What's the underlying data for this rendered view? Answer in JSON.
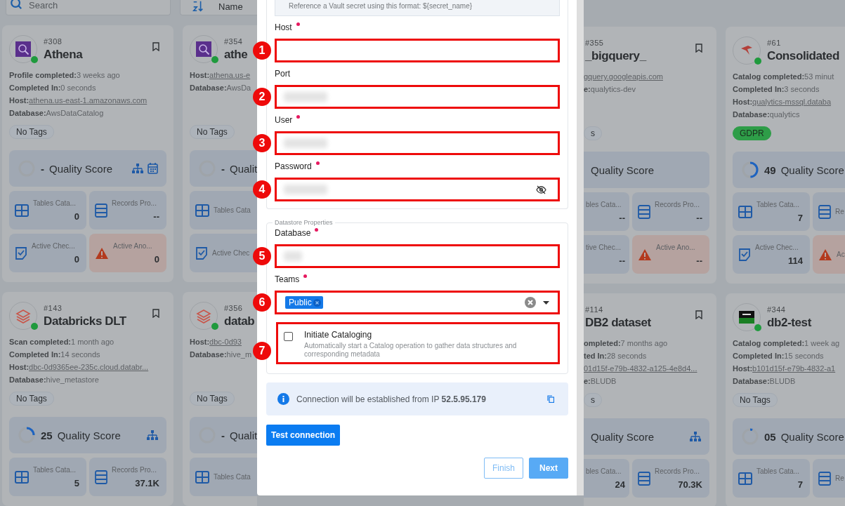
{
  "toolbar": {
    "search_placeholder": "Search",
    "sort_value": "Name"
  },
  "card_columns": [
    {
      "cards": [
        {
          "id": "#308",
          "title": "Athena",
          "logo": {
            "kind": "athena"
          },
          "online": true,
          "bookmark": true,
          "info": [
            {
              "label": "Profile completed:",
              "value": "3 weeks ago",
              "link": false
            },
            {
              "label": "Completed In:",
              "value": "0 seconds",
              "link": false
            },
            {
              "label": "Host:",
              "value": "athena.us-east-1.amazonaws.com",
              "link": true
            },
            {
              "label": "Database:",
              "value": "AwsDataCatalog",
              "link": false
            }
          ],
          "tag": {
            "label": "No Tags",
            "kind": "empty"
          },
          "quality": {
            "score": "-",
            "label": "Quality Score",
            "icons": [
              {
                "kind": "tree"
              },
              {
                "kind": "calendar"
              }
            ]
          },
          "stat_rows": [
            [
              {
                "kind": "tables",
                "label": "Tables Cata...",
                "value": "0"
              },
              {
                "kind": "records",
                "label": "Records Pro...",
                "value": "--"
              }
            ],
            [
              {
                "kind": "checks",
                "label": "Active Chec...",
                "value": "0"
              },
              {
                "kind": "anomalies",
                "label": "Active Ano...",
                "value": "0"
              }
            ]
          ]
        },
        {
          "id": "#143",
          "title": "Databricks DLT",
          "logo": {
            "kind": "databricks"
          },
          "online": true,
          "bookmark": true,
          "info": [
            {
              "label": "Scan completed:",
              "value": "1 month ago",
              "link": false
            },
            {
              "label": "Completed In:",
              "value": "14 seconds",
              "link": false
            },
            {
              "label": "Host:",
              "value": "dbc-0d9365ee-235c.cloud.databr...",
              "link": true
            },
            {
              "label": "Database:",
              "value": "hive_metastore",
              "link": false
            }
          ],
          "tag": {
            "label": "No Tags",
            "kind": "empty"
          },
          "quality": {
            "score": "25",
            "label": "Quality Score",
            "icons": [
              {
                "kind": "tree"
              }
            ]
          },
          "stat_rows": [
            [
              {
                "kind": "tables",
                "label": "Tables Cata...",
                "value": "5"
              },
              {
                "kind": "records",
                "label": "Records Pro...",
                "value": "37.1K"
              }
            ]
          ]
        }
      ]
    },
    {
      "cards": [
        {
          "id": "#354",
          "title": "athe",
          "logo": {
            "kind": "athena"
          },
          "online": true,
          "info": [
            {
              "label": "Host:",
              "value": "athena.us-e",
              "link": true
            },
            {
              "label": "Database:",
              "value": "AwsDa",
              "link": false
            }
          ],
          "tag": {
            "label": "No Tags",
            "kind": "empty"
          },
          "quality": {
            "score": "-",
            "label": "Qualit"
          },
          "stat_rows": [
            [
              {
                "kind": "tables",
                "label": "Tables Cata"
              }
            ],
            [
              {
                "kind": "checks",
                "label": "Active Chec"
              }
            ]
          ]
        },
        {
          "id": "#356",
          "title": "datab",
          "logo": {
            "kind": "databricks"
          },
          "online": true,
          "info": [
            {
              "label": "Host:",
              "value": "dbc-0d93",
              "link": true
            },
            {
              "label": "Database:",
              "value": "hive_m",
              "link": false
            }
          ],
          "tag": {
            "label": "No Tags",
            "kind": "empty"
          },
          "quality": {
            "score": "-",
            "label": "Qualit"
          },
          "stat_rows": [
            [
              {
                "kind": "tables",
                "label": "Tables Cata"
              }
            ]
          ]
        }
      ]
    },
    {
      "cards": [
        {
          "id": "#355",
          "title": "_bigquery_",
          "bookmark": true,
          "info": [
            {
              "value": "gquery.googleapis.com",
              "link": true
            },
            {
              "label": "e:",
              "value": "qualytics-dev",
              "link": false
            }
          ],
          "tag": {
            "label": "s",
            "kind": "empty"
          },
          "quality": {
            "label": "Quality Score"
          },
          "stat_rows": [
            [
              {
                "label": "bles Cata...",
                "value": "--"
              },
              {
                "kind": "records",
                "label": "Records Pro...",
                "value": "--"
              }
            ],
            [
              {
                "label": "tive Chec...",
                "value": "--"
              },
              {
                "kind": "anomalies",
                "label": "Active Ano...",
                "value": "--"
              }
            ]
          ]
        },
        {
          "id": "#114",
          "title": "DB2 dataset",
          "bookmark": true,
          "info": [
            {
              "label": "ompleted:",
              "value": "7 months ago",
              "link": false
            },
            {
              "label": "ted In:",
              "value": "28 seconds",
              "link": false
            },
            {
              "value": "01d15f-e79b-4832-a125-4e8d4...",
              "link": true
            },
            {
              "label": "e:",
              "value": "BLUDB",
              "link": false
            }
          ],
          "tag": {
            "label": "s",
            "kind": "empty"
          },
          "quality": {
            "label": "Quality Score",
            "icons": [
              {
                "kind": "tree"
              }
            ]
          },
          "stat_rows": [
            [
              {
                "label": "bles Cata...",
                "value": "24"
              },
              {
                "kind": "records",
                "label": "Records Pro...",
                "value": "70.3K"
              }
            ]
          ]
        }
      ]
    },
    {
      "cards": [
        {
          "id": "#61",
          "title": "Consolidated",
          "logo": {
            "kind": "mssql"
          },
          "online": true,
          "info": [
            {
              "label": "Catalog completed:",
              "value": "53 minut",
              "link": false
            },
            {
              "label": "Completed In:",
              "value": "3 seconds",
              "link": false
            },
            {
              "label": "Host:",
              "value": "qualytics-mssql.databa",
              "link": true
            },
            {
              "label": "Database:",
              "value": "qualytics",
              "link": false
            }
          ],
          "tag": {
            "label": "GDPR",
            "kind": "gdpr"
          },
          "quality": {
            "score": "49",
            "label": "Quality Score"
          },
          "stat_rows": [
            [
              {
                "kind": "tables",
                "label": "Tables Cata...",
                "value": "7"
              },
              {
                "kind": "records",
                "label": "Re"
              }
            ],
            [
              {
                "kind": "checks",
                "label": "Active Chec...",
                "value": "114"
              },
              {
                "kind": "anomalies",
                "label": "Ac"
              }
            ]
          ]
        },
        {
          "id": "#344",
          "title": "db2-test",
          "logo": {
            "kind": "ibm"
          },
          "online": true,
          "info": [
            {
              "label": "Catalog completed:",
              "value": "1 week ag",
              "link": false
            },
            {
              "label": "Completed In:",
              "value": "15 seconds",
              "link": false
            },
            {
              "label": "Host:",
              "value": "b101d15f-e79b-4832-a1",
              "link": true
            },
            {
              "label": "Database:",
              "value": "BLUDB",
              "link": false
            }
          ],
          "tag": {
            "label": "No Tags",
            "kind": "empty"
          },
          "quality": {
            "score": "05",
            "label": "Quality Score"
          },
          "stat_rows": [
            [
              {
                "kind": "tables",
                "label": "Tables Cata...",
                "value": "7"
              },
              {
                "kind": "records",
                "label": "Re"
              }
            ]
          ]
        }
      ]
    }
  ],
  "modal": {
    "vault_hint": "Reference a Vault secret using this format: ${secret_name}",
    "connection_fields": [
      {
        "label": "Host",
        "required": true,
        "marker": "1",
        "blurred": false,
        "kind": "text"
      },
      {
        "label": "Port",
        "required": false,
        "marker": "2",
        "blurred": true,
        "kind": "text"
      },
      {
        "label": "User",
        "required": true,
        "marker": "3",
        "blurred": true,
        "kind": "text"
      },
      {
        "label": "Password",
        "required": true,
        "marker": "4",
        "blurred": true,
        "kind": "password"
      }
    ],
    "datastore": {
      "legend": "Datastore Properties",
      "database": {
        "label": "Database",
        "required": true,
        "marker": "5",
        "blurred": true
      },
      "teams": {
        "label": "Teams",
        "required": true,
        "marker": "6",
        "chips": [
          "Public"
        ]
      },
      "cataloging": {
        "marker": "7",
        "label": "Initiate Cataloging",
        "description": "Automatically start a Catalog operation to gather data structures and corresponding metadata",
        "checked": false
      }
    },
    "ip_notice": "Connection will be established from IP **52.5.95.179**",
    "test_button": "Test connection",
    "footer_buttons": [
      {
        "label": "Finish",
        "kind": "outline",
        "disabled": true
      },
      {
        "label": "Next",
        "kind": "primary",
        "disabled": true
      }
    ]
  }
}
